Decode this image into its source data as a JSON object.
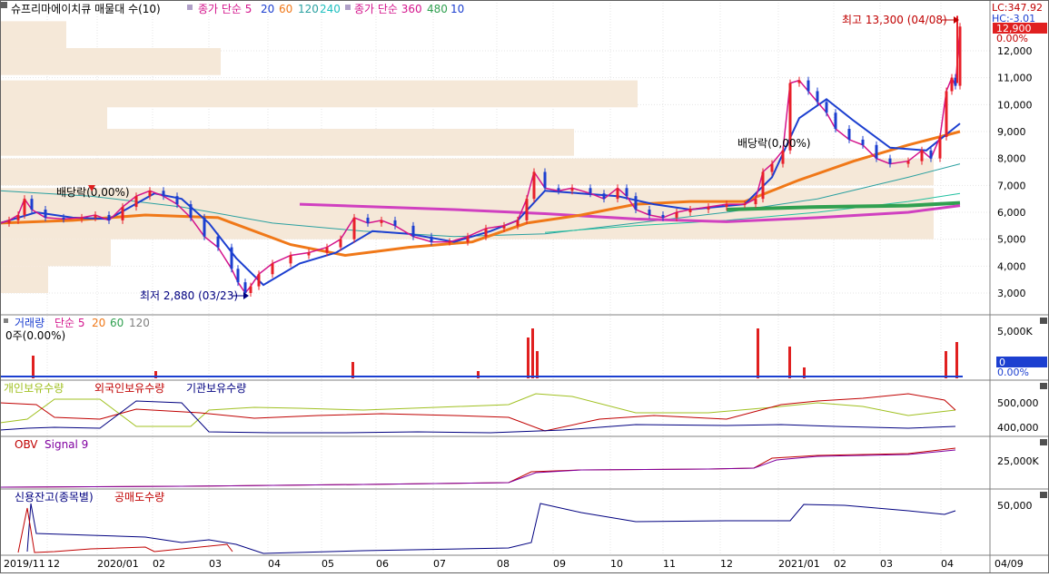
{
  "main_panel": {
    "legend": {
      "symbol": "슈프리마에이치큐 매물대 수(10)",
      "ma_label_1": "종가 단순 5",
      "ma_periods_1": [
        "5",
        "20",
        "60",
        "120",
        "240"
      ],
      "ma_label_2": "종가 단순 360",
      "ma_periods_2": [
        "360",
        "480",
        "10"
      ]
    },
    "annotations": {
      "high": "최고 13,300 (04/08)",
      "low": "최저 2,880 (03/23)",
      "dividend_1": "배당락(0,00%)",
      "dividend_2": "배당락(0,00%)"
    },
    "right_labels": {
      "lc": "LC:347.92",
      "hc": "HC:-3.01",
      "current_price": "12,900",
      "change_pct": "0.00%"
    },
    "y_ticks": [
      "12,000",
      "11,000",
      "10,000",
      "9,000",
      "8,000",
      "7,000",
      "6,000",
      "5,000",
      "4,000",
      "3,000"
    ]
  },
  "volume_panel": {
    "legend_title": "거래량",
    "legend_ma": "단순 5",
    "legend_periods": [
      "20",
      "60",
      "120"
    ],
    "left_label": "0주(0.00%)",
    "y_ticks": [
      "5,000K"
    ],
    "current_value": "0",
    "current_pct": "0.00%"
  },
  "holders_panel": {
    "legend": [
      "개인보유수량",
      "외국인보유수량",
      "기관보유수량"
    ],
    "y_ticks": [
      "500,000",
      "400,000"
    ]
  },
  "obv_panel": {
    "legend": [
      "OBV",
      "Signal 9"
    ],
    "y_ticks": [
      "25,000K"
    ]
  },
  "credit_panel": {
    "legend": [
      "신용잔고(종목별)",
      "공매도수량"
    ],
    "y_ticks": [
      "50,000"
    ]
  },
  "x_axis": {
    "labels": [
      "2019/11",
      "12",
      "2020/01",
      "02",
      "03",
      "04",
      "05",
      "06",
      "07",
      "08",
      "09",
      "10",
      "11",
      "12",
      "2021/01",
      "02",
      "03",
      "04",
      "04/09"
    ]
  },
  "colors": {
    "up_candle": "#e8202a",
    "down_candle": "#1c3fd0",
    "ma5": "#d4148c",
    "ma20": "#1c3fd0",
    "ma60": "#f07818",
    "ma120": "#2aa0a0",
    "ma240": "#1ca070",
    "ma360": "#d040c0",
    "ma480": "#30a050",
    "volume_profile": "#f5e8d8",
    "current_price_bg": "#e02020"
  },
  "chart_data": {
    "type": "candlestick",
    "period": "daily",
    "y_range": [
      2500,
      13500
    ],
    "high": {
      "value": 13300,
      "date": "04/08"
    },
    "low": {
      "value": 2880,
      "date": "03/23"
    },
    "close_series": [
      [
        0,
        5600
      ],
      [
        10,
        5700
      ],
      [
        20,
        5900
      ],
      [
        27,
        6500
      ],
      [
        35,
        6100
      ],
      [
        50,
        5800
      ],
      [
        70,
        5750
      ],
      [
        90,
        5800
      ],
      [
        105,
        5900
      ],
      [
        120,
        5700
      ],
      [
        135,
        6200
      ],
      [
        150,
        6600
      ],
      [
        165,
        6800
      ],
      [
        180,
        6600
      ],
      [
        195,
        6300
      ],
      [
        210,
        5800
      ],
      [
        225,
        5100
      ],
      [
        240,
        4700
      ],
      [
        255,
        3900
      ],
      [
        262,
        3400
      ],
      [
        270,
        3000
      ],
      [
        276,
        3250
      ],
      [
        285,
        3700
      ],
      [
        300,
        4100
      ],
      [
        320,
        4400
      ],
      [
        340,
        4500
      ],
      [
        360,
        4700
      ],
      [
        375,
        5000
      ],
      [
        390,
        5800
      ],
      [
        405,
        5600
      ],
      [
        420,
        5700
      ],
      [
        435,
        5500
      ],
      [
        455,
        5100
      ],
      [
        475,
        4900
      ],
      [
        495,
        4900
      ],
      [
        515,
        5100
      ],
      [
        535,
        5400
      ],
      [
        555,
        5500
      ],
      [
        570,
        5700
      ],
      [
        580,
        6500
      ],
      [
        588,
        7500
      ],
      [
        600,
        6900
      ],
      [
        615,
        6800
      ],
      [
        630,
        6900
      ],
      [
        650,
        6700
      ],
      [
        665,
        6500
      ],
      [
        680,
        6900
      ],
      [
        690,
        6600
      ],
      [
        700,
        6100
      ],
      [
        715,
        5900
      ],
      [
        730,
        5800
      ],
      [
        745,
        6000
      ],
      [
        760,
        6100
      ],
      [
        780,
        6200
      ],
      [
        800,
        6300
      ],
      [
        820,
        6300
      ],
      [
        832,
        6500
      ],
      [
        840,
        7500
      ],
      [
        850,
        7800
      ],
      [
        862,
        8300
      ],
      [
        870,
        10800
      ],
      [
        880,
        10900
      ],
      [
        890,
        10500
      ],
      [
        900,
        10100
      ],
      [
        910,
        9700
      ],
      [
        920,
        9100
      ],
      [
        935,
        8700
      ],
      [
        950,
        8500
      ],
      [
        965,
        8000
      ],
      [
        980,
        7800
      ],
      [
        1000,
        7900
      ],
      [
        1015,
        8300
      ],
      [
        1025,
        8000
      ],
      [
        1035,
        8800
      ],
      [
        1042,
        10500
      ],
      [
        1048,
        11000
      ],
      [
        1052,
        10700
      ],
      [
        1057,
        12900
      ]
    ],
    "ma20_series": [
      [
        0,
        5600
      ],
      [
        40,
        6000
      ],
      [
        80,
        5800
      ],
      [
        120,
        5750
      ],
      [
        170,
        6700
      ],
      [
        200,
        6500
      ],
      [
        230,
        5600
      ],
      [
        260,
        4300
      ],
      [
        290,
        3300
      ],
      [
        330,
        4100
      ],
      [
        370,
        4500
      ],
      [
        410,
        5300
      ],
      [
        450,
        5200
      ],
      [
        500,
        4900
      ],
      [
        540,
        5300
      ],
      [
        570,
        5700
      ],
      [
        600,
        6800
      ],
      [
        640,
        6700
      ],
      [
        680,
        6600
      ],
      [
        720,
        6300
      ],
      [
        760,
        6100
      ],
      [
        820,
        6300
      ],
      [
        850,
        7300
      ],
      [
        880,
        9500
      ],
      [
        910,
        10200
      ],
      [
        940,
        9400
      ],
      [
        980,
        8400
      ],
      [
        1020,
        8300
      ],
      [
        1057,
        9300
      ]
    ],
    "ma60_series": [
      [
        0,
        5600
      ],
      [
        80,
        5700
      ],
      [
        160,
        5900
      ],
      [
        240,
        5800
      ],
      [
        320,
        4800
      ],
      [
        380,
        4400
      ],
      [
        450,
        4700
      ],
      [
        520,
        4900
      ],
      [
        580,
        5600
      ],
      [
        640,
        5900
      ],
      [
        700,
        6300
      ],
      [
        760,
        6400
      ],
      [
        820,
        6400
      ],
      [
        880,
        7200
      ],
      [
        940,
        7900
      ],
      [
        1000,
        8500
      ],
      [
        1057,
        9000
      ]
    ],
    "ma120_series": [
      [
        0,
        6800
      ],
      [
        100,
        6600
      ],
      [
        200,
        6200
      ],
      [
        300,
        5600
      ],
      [
        400,
        5300
      ],
      [
        500,
        5100
      ],
      [
        600,
        5200
      ],
      [
        700,
        5600
      ],
      [
        800,
        6000
      ],
      [
        900,
        6500
      ],
      [
        1000,
        7300
      ],
      [
        1057,
        7800
      ]
    ],
    "ma240_series": [
      [
        600,
        5250
      ],
      [
        700,
        5500
      ],
      [
        800,
        5700
      ],
      [
        900,
        6000
      ],
      [
        1000,
        6400
      ],
      [
        1057,
        6700
      ]
    ],
    "ma360_series": [
      [
        330,
        6300
      ],
      [
        500,
        6100
      ],
      [
        600,
        5950
      ],
      [
        700,
        5750
      ],
      [
        800,
        5650
      ],
      [
        900,
        5800
      ],
      [
        1000,
        6000
      ],
      [
        1057,
        6250
      ]
    ],
    "ma480_series": [
      [
        800,
        6100
      ],
      [
        900,
        6200
      ],
      [
        1000,
        6250
      ],
      [
        1057,
        6350
      ]
    ],
    "volume_profile_prices": [
      11600,
      12600,
      10400,
      9600,
      8600,
      7500,
      6400,
      5500,
      4500,
      3500
    ],
    "volume_profile_values": [
      243,
      73,
      702,
      118,
      632,
      1028,
      1028,
      1028,
      122,
      53
    ]
  }
}
